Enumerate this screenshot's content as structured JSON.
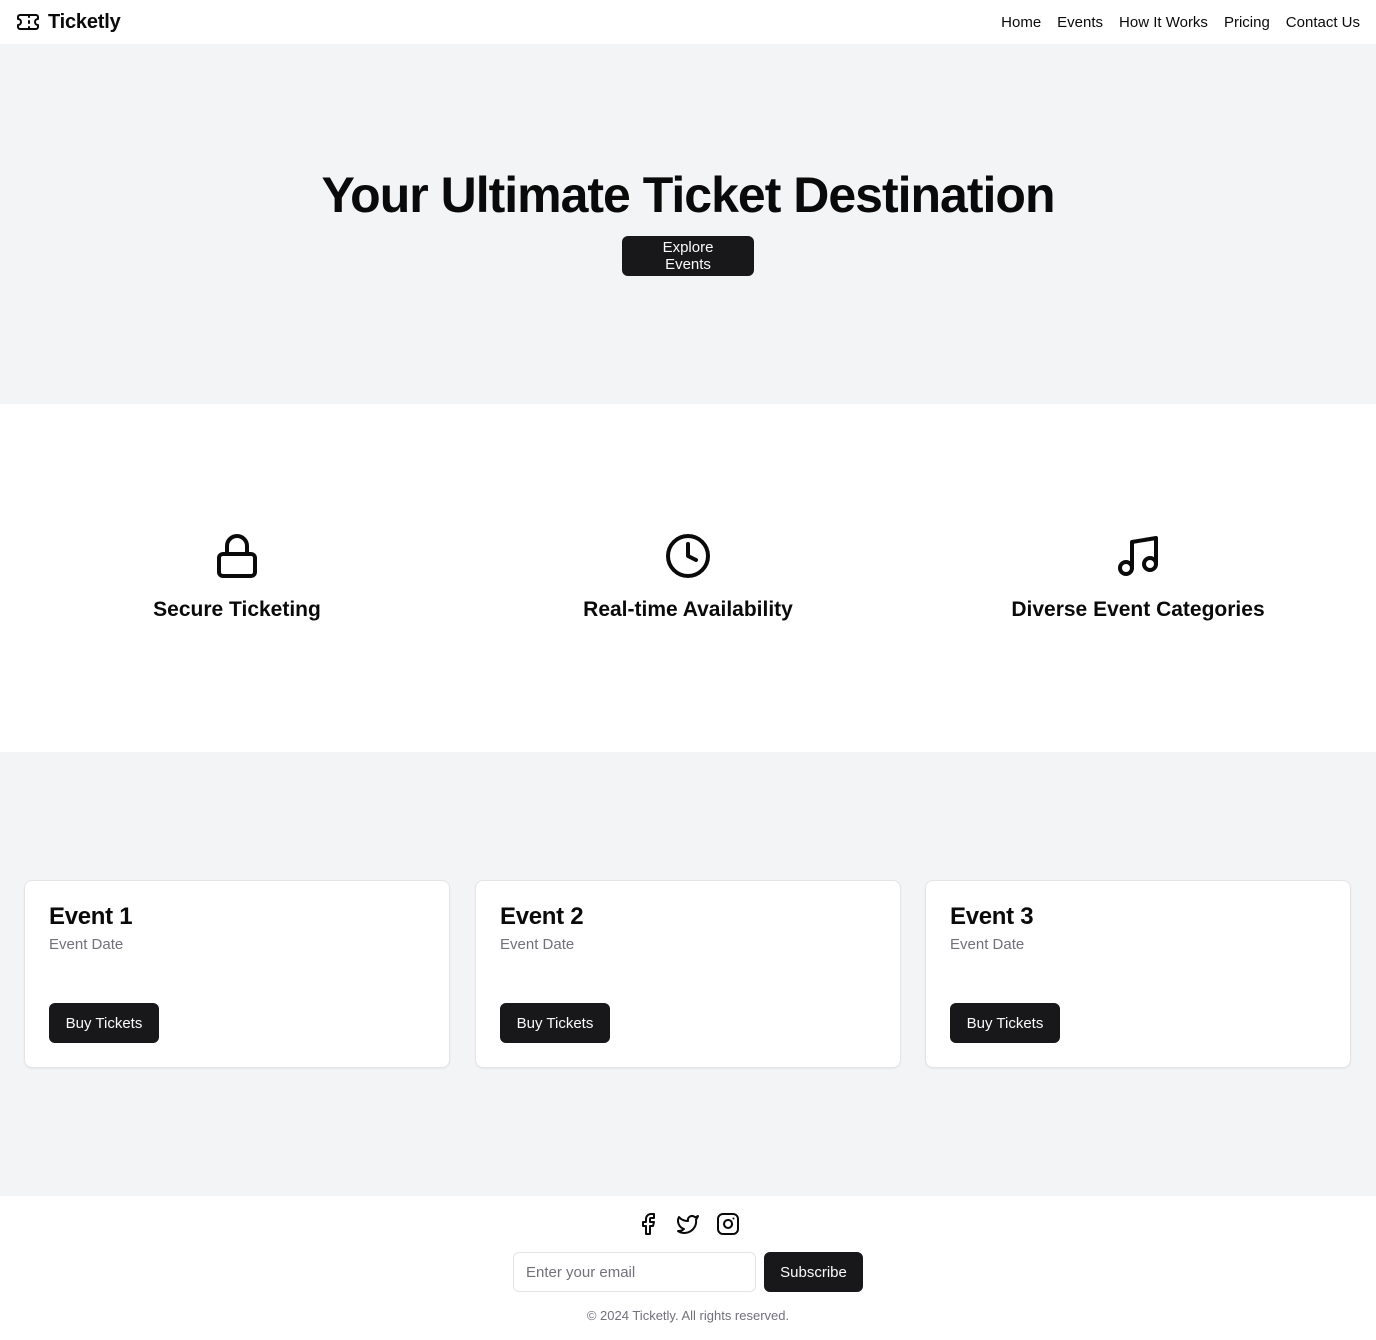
{
  "header": {
    "brand": "Ticketly",
    "brand_icon": "ticket-icon",
    "nav": [
      "Home",
      "Events",
      "How It Works",
      "Pricing",
      "Contact Us"
    ]
  },
  "hero": {
    "title": "Your Ultimate Ticket Destination",
    "cta_label": "Explore Events"
  },
  "features": [
    {
      "icon": "lock-icon",
      "title": "Secure Ticketing"
    },
    {
      "icon": "clock-icon",
      "title": "Real-time Availability"
    },
    {
      "icon": "music-note-icon",
      "title": "Diverse Event Categories"
    }
  ],
  "events": [
    {
      "title": "Event 1",
      "date": "Event Date",
      "button": "Buy Tickets"
    },
    {
      "title": "Event 2",
      "date": "Event Date",
      "button": "Buy Tickets"
    },
    {
      "title": "Event 3",
      "date": "Event Date",
      "button": "Buy Tickets"
    }
  ],
  "footer": {
    "socials": [
      "facebook-icon",
      "twitter-icon",
      "instagram-icon"
    ],
    "email_placeholder": "Enter your email",
    "email_value": "",
    "subscribe_label": "Subscribe",
    "copyright": "© 2024 Ticketly. All rights reserved."
  },
  "colors": {
    "primary_button": "#18181b",
    "section_background": "#f3f4f6",
    "muted_text": "#71717a",
    "border": "#e4e4e7"
  }
}
